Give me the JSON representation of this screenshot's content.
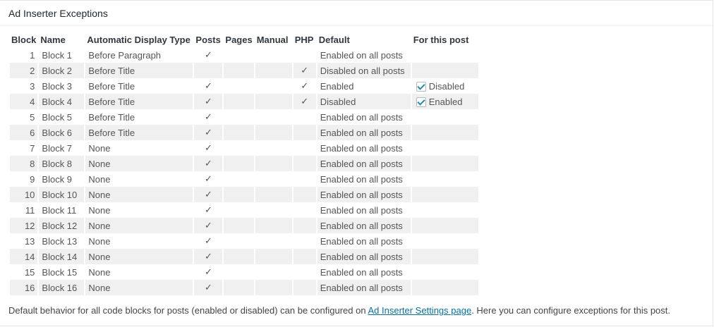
{
  "header": {
    "title": "Ad Inserter Exceptions"
  },
  "columns": {
    "block": "Block",
    "name": "Name",
    "type": "Automatic Display Type",
    "posts": "Posts",
    "pages": "Pages",
    "manual": "Manual",
    "php": "PHP",
    "default": "Default",
    "for_post": "For this post"
  },
  "check_glyph": "✓",
  "rows": [
    {
      "block": "1",
      "name": "Block 1",
      "type": "Before Paragraph",
      "posts": "✓",
      "pages": "",
      "manual": "",
      "php": "",
      "default": "Enabled on all posts",
      "for_post": ""
    },
    {
      "block": "2",
      "name": "Block 2",
      "type": "Before Title",
      "posts": "",
      "pages": "",
      "manual": "",
      "php": "✓",
      "default": "Disabled on all posts",
      "for_post": ""
    },
    {
      "block": "3",
      "name": "Block 3",
      "type": "Before Title",
      "posts": "✓",
      "pages": "",
      "manual": "",
      "php": "✓",
      "default": "Enabled",
      "for_post": "Disabled"
    },
    {
      "block": "4",
      "name": "Block 4",
      "type": "Before Title",
      "posts": "✓",
      "pages": "",
      "manual": "",
      "php": "✓",
      "default": "Disabled",
      "for_post": "Enabled"
    },
    {
      "block": "5",
      "name": "Block 5",
      "type": "Before Title",
      "posts": "✓",
      "pages": "",
      "manual": "",
      "php": "",
      "default": "Enabled on all posts",
      "for_post": ""
    },
    {
      "block": "6",
      "name": "Block 6",
      "type": "Before Title",
      "posts": "✓",
      "pages": "",
      "manual": "",
      "php": "",
      "default": "Enabled on all posts",
      "for_post": ""
    },
    {
      "block": "7",
      "name": "Block 7",
      "type": "None",
      "posts": "✓",
      "pages": "",
      "manual": "",
      "php": "",
      "default": "Enabled on all posts",
      "for_post": ""
    },
    {
      "block": "8",
      "name": "Block 8",
      "type": "None",
      "posts": "✓",
      "pages": "",
      "manual": "",
      "php": "",
      "default": "Enabled on all posts",
      "for_post": ""
    },
    {
      "block": "9",
      "name": "Block 9",
      "type": "None",
      "posts": "✓",
      "pages": "",
      "manual": "",
      "php": "",
      "default": "Enabled on all posts",
      "for_post": ""
    },
    {
      "block": "10",
      "name": "Block 10",
      "type": "None",
      "posts": "✓",
      "pages": "",
      "manual": "",
      "php": "",
      "default": "Enabled on all posts",
      "for_post": ""
    },
    {
      "block": "11",
      "name": "Block 11",
      "type": "None",
      "posts": "✓",
      "pages": "",
      "manual": "",
      "php": "",
      "default": "Enabled on all posts",
      "for_post": ""
    },
    {
      "block": "12",
      "name": "Block 12",
      "type": "None",
      "posts": "✓",
      "pages": "",
      "manual": "",
      "php": "",
      "default": "Enabled on all posts",
      "for_post": ""
    },
    {
      "block": "13",
      "name": "Block 13",
      "type": "None",
      "posts": "✓",
      "pages": "",
      "manual": "",
      "php": "",
      "default": "Enabled on all posts",
      "for_post": ""
    },
    {
      "block": "14",
      "name": "Block 14",
      "type": "None",
      "posts": "✓",
      "pages": "",
      "manual": "",
      "php": "",
      "default": "Enabled on all posts",
      "for_post": ""
    },
    {
      "block": "15",
      "name": "Block 15",
      "type": "None",
      "posts": "✓",
      "pages": "",
      "manual": "",
      "php": "",
      "default": "Enabled on all posts",
      "for_post": ""
    },
    {
      "block": "16",
      "name": "Block 16",
      "type": "None",
      "posts": "✓",
      "pages": "",
      "manual": "",
      "php": "",
      "default": "Enabled on all posts",
      "for_post": ""
    }
  ],
  "footer": {
    "text_before": "Default behavior for all code blocks for posts (enabled or disabled) can be configured on ",
    "link": "Ad Inserter Settings page",
    "text_after": ". Here you can configure exceptions for this post."
  }
}
